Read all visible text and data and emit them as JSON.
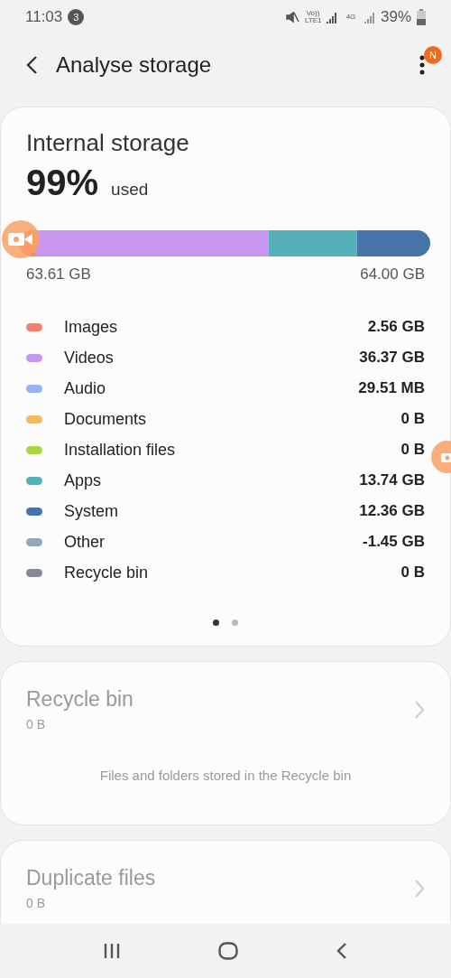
{
  "status_bar": {
    "time": "11:03",
    "notification_count": "3",
    "volte": "Vo))",
    "lte": "LTE1",
    "network": "4G",
    "battery": "39%"
  },
  "header": {
    "title": "Analyse storage",
    "menu_badge": "N"
  },
  "storage_card": {
    "title": "Internal storage",
    "percent": "99%",
    "percent_suffix": "used",
    "used_label": "63.61 GB",
    "total_label": "64.00 GB",
    "categories": [
      {
        "name": "Images",
        "size": "2.56 GB",
        "color": "#f08070"
      },
      {
        "name": "Videos",
        "size": "36.37 GB",
        "color": "#c898f0"
      },
      {
        "name": "Audio",
        "size": "29.51 MB",
        "color": "#90b4f4"
      },
      {
        "name": "Documents",
        "size": "0 B",
        "color": "#f4b860"
      },
      {
        "name": "Installation files",
        "size": "0 B",
        "color": "#a8d840"
      },
      {
        "name": "Apps",
        "size": "13.74 GB",
        "color": "#56b0b8"
      },
      {
        "name": "System",
        "size": "12.36 GB",
        "color": "#4474a8"
      },
      {
        "name": "Other",
        "size": "-1.45 GB",
        "color": "#8fa8bc"
      },
      {
        "name": "Recycle bin",
        "size": "0 B",
        "color": "#868a98"
      }
    ],
    "pages": [
      {
        "selected": true
      },
      {
        "selected": false
      }
    ]
  },
  "cards": [
    {
      "title": "Recycle bin",
      "size": "0 B",
      "description": "Files and folders stored in the Recycle bin",
      "disabled": true
    },
    {
      "title": "Duplicate files",
      "size": "0 B",
      "disabled": true
    }
  ]
}
